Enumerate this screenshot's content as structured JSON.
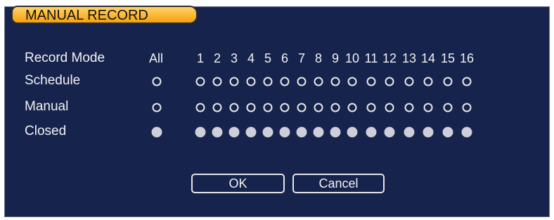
{
  "window": {
    "title": "MANUAL RECORD"
  },
  "header": {
    "row_label": "Record Mode",
    "all_label": "All",
    "channels": [
      "1",
      "2",
      "3",
      "4",
      "5",
      "6",
      "7",
      "8",
      "9",
      "10",
      "11",
      "12",
      "13",
      "14",
      "15",
      "16"
    ]
  },
  "rows": [
    {
      "label": "Schedule",
      "selected": false
    },
    {
      "label": "Manual",
      "selected": false
    },
    {
      "label": "Closed",
      "selected": true
    }
  ],
  "buttons": {
    "ok": "OK",
    "cancel": "Cancel"
  },
  "colors": {
    "background": "#16234c",
    "title_tab": "#f6a10a",
    "text": "#f2f2f2",
    "radio_selected": "#cfcfdc"
  }
}
